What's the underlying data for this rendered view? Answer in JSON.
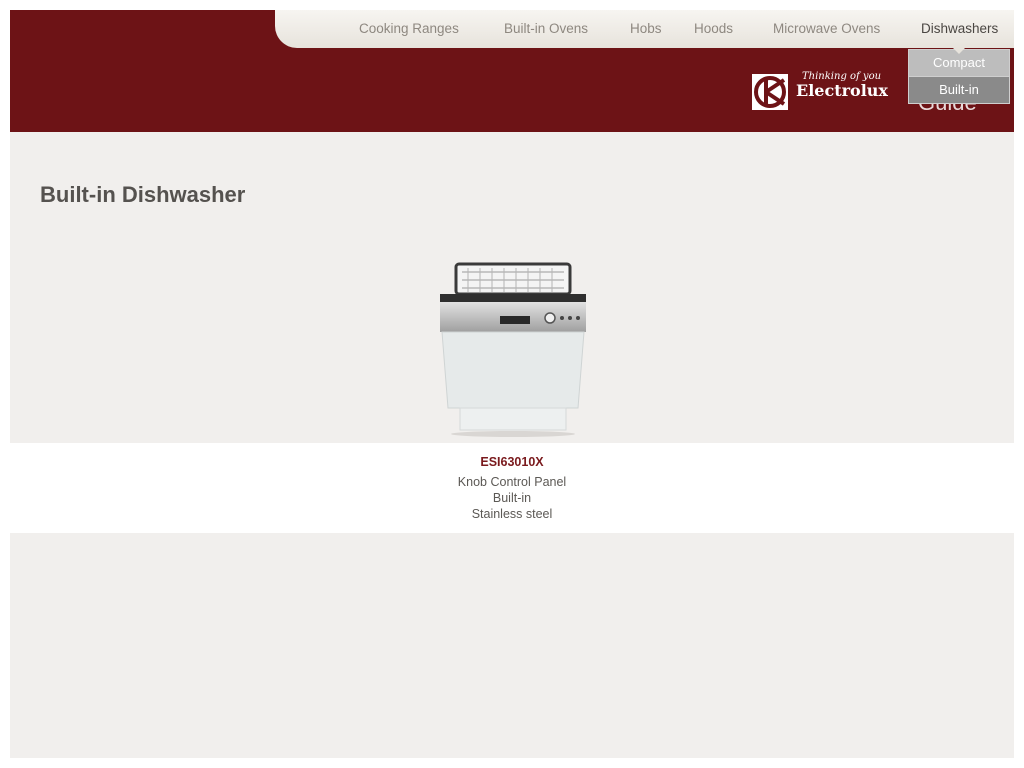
{
  "nav": {
    "items": [
      {
        "label": "Cooking Ranges"
      },
      {
        "label": "Built-in Ovens"
      },
      {
        "label": "Hobs"
      },
      {
        "label": "Hoods"
      },
      {
        "label": "Microwave Ovens"
      },
      {
        "label": "Dishwashers"
      }
    ],
    "active": "Dishwashers"
  },
  "dropdown": {
    "items": [
      {
        "label": "Compact"
      },
      {
        "label": "Built-in"
      }
    ]
  },
  "brand": {
    "tagline": "Thinking of you",
    "name": "Electrolux",
    "guide_text": "Guide"
  },
  "page": {
    "title": "Built-in Dishwasher"
  },
  "product": {
    "model": "ESI63010X",
    "specs": [
      "Knob Control Panel",
      "Built-in",
      "Stainless steel"
    ]
  },
  "colors": {
    "header": "#6d1316",
    "background": "#f1efed",
    "model_text": "#7a1a1d"
  }
}
